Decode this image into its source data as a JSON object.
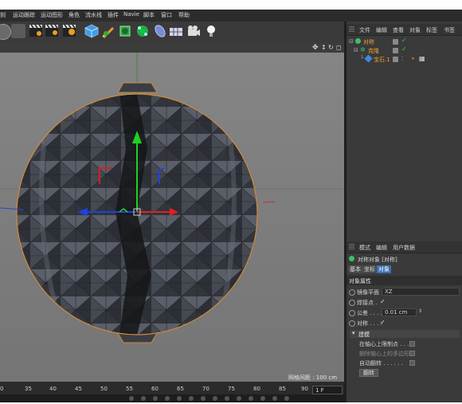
{
  "menu": [
    "刻",
    "运动跟踪",
    "运动图形",
    "角色",
    "流水线",
    "插件",
    "Navie",
    "脚本",
    "窗口",
    "帮助"
  ],
  "object_manager": {
    "tabs": [
      "文件",
      "编辑",
      "查看",
      "对象",
      "标签",
      "书签"
    ],
    "objects": [
      {
        "name": "对称",
        "level": 0
      },
      {
        "name": "克隆",
        "level": 1
      },
      {
        "name": "宝石.1",
        "level": 2
      }
    ]
  },
  "attribute_manager": {
    "tabs": [
      "模式",
      "编辑",
      "用户数据"
    ],
    "object_title": "对称对象 [对称]",
    "subtabs": [
      "基本",
      "坐标",
      "对象"
    ],
    "active_subtab": "对象",
    "section_title": "对象属性",
    "fields": [
      {
        "label": "镜像平面",
        "value": "XZ"
      },
      {
        "label": "焊接点 .",
        "value": "✓"
      },
      {
        "label": "公差 . . . . .",
        "value": "0.01 cm"
      },
      {
        "label": "对称 . . . .",
        "value": "✓"
      }
    ],
    "modeling_header": "建模",
    "modeling_options": [
      {
        "label": "在轴心上限制点 . . ."
      },
      {
        "label": "删除轴心上的多边形"
      },
      {
        "label": "自动翻转 . . . . . ."
      }
    ],
    "flip_button": "翻转"
  },
  "viewport": {
    "grid_spacing": "网格间距 : 100 cm"
  },
  "timeline": {
    "ticks": [
      "0",
      "35",
      "40",
      "45",
      "50",
      "55",
      "60",
      "65",
      "70",
      "75",
      "80",
      "85",
      "90"
    ],
    "current_frame": "1 F"
  },
  "colors": {
    "accent_orange": "#f0a030",
    "axis_y": "#1fd01f",
    "axis_x": "#e02020",
    "axis_z": "#2040e0",
    "gem_surface": "#3a3d44"
  },
  "icons": [
    "toolbar-cube-icon",
    "pen-icon",
    "nurbs-icon",
    "deformer-icon",
    "scene-icon",
    "camera-icon",
    "light-icon"
  ]
}
